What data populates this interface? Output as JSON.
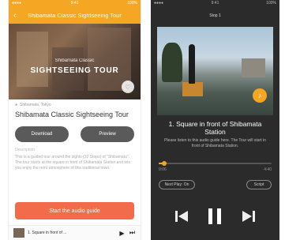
{
  "left_screen": {
    "status_left": "●●●●",
    "status_time": "9:41",
    "status_right": "100%",
    "nav_title": "Shibamata Classic Sightseeing Tour",
    "hero_subtitle": "Shibamata Classic",
    "hero_title": "SIGHTSEEING TOUR",
    "location": "Shibamata, Tokyo",
    "tour_title": "Shibamata Classic Sightseeing Tour",
    "left_button": "Download",
    "right_button": "Preview",
    "description_heading": "Description",
    "description": "This is a guided tour around the sights (32 Stops) of \"Shibamata\". The tour starts at the square in front of Shibamata Station and lets you enjoy the retro atmosphere of this traditional town.",
    "cta": "Start the audio guide",
    "mini_player_title": "1. Square in front of ..."
  },
  "right_screen": {
    "status_left": "●●●●",
    "status_time": "9:41",
    "status_right": "100%",
    "nav_title": "Stop 1",
    "stop_title_line1": "1. Square in front of Shibamata",
    "stop_title_line2": "Station",
    "stop_description": "Please listen to this audio guide here. The Tour will start in front of Shibamata Station.",
    "elapsed": "0:06",
    "duration": "4:40",
    "progress": 0.05,
    "left_chip": "Next Play: On",
    "right_chip": "Script"
  },
  "colors": {
    "accent": "#f5a623",
    "cta": "#f26b4a",
    "dark_bg": "#2b2b2b"
  },
  "icons": {
    "back": "chevron-left-icon",
    "location": "pin-icon",
    "prev": "skip-back-icon",
    "play_pause": "pause-icon",
    "next": "skip-forward-icon"
  }
}
